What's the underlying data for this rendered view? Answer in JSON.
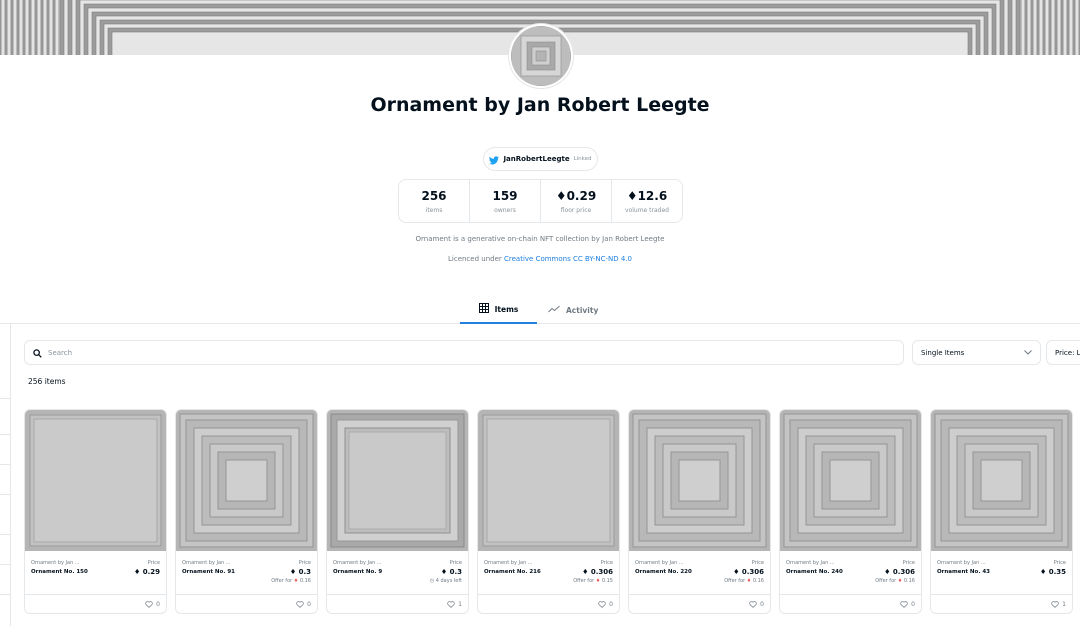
{
  "collection": {
    "title": "Ornament by Jan Robert Leegte",
    "twitter_handle": "JanRobertLeegte",
    "twitter_status": "Linked",
    "description": "Ornament is a generative on-chain NFT collection by Jan Robert Leegte",
    "licence_prefix": "Licenced under ",
    "licence_link": "Creative Commons CC BY-NC-ND 4.0"
  },
  "stats": [
    {
      "value": "256",
      "label": "items"
    },
    {
      "value": "159",
      "label": "owners"
    },
    {
      "value": "0.29",
      "label": "floor price",
      "eth": true
    },
    {
      "value": "12.6",
      "label": "volume traded",
      "eth": true
    }
  ],
  "tabs": {
    "items_label": "Items",
    "activity_label": "Activity"
  },
  "toolbar": {
    "search_placeholder": "Search",
    "item_type": "Single Items",
    "sort": "Price: Lo"
  },
  "item_count": "256 items",
  "cards": [
    {
      "collection": "Ornament by Jan ...",
      "name": "Ornament No. 150",
      "price_label": "Price",
      "price": "0.29",
      "extra": "",
      "offer": "",
      "likes": "0",
      "pattern": "plain"
    },
    {
      "collection": "Ornament by Jan ...",
      "name": "Ornament No. 91",
      "price_label": "Price",
      "price": "0.3",
      "extra": "Offer for ",
      "offer": "0.16",
      "likes": "0",
      "pattern": "nested"
    },
    {
      "collection": "Ornament by Jan ...",
      "name": "Ornament No. 9",
      "price_label": "Price",
      "price": "0.3",
      "extra": "4 days left",
      "offer": "",
      "likes": "1",
      "pattern": "bevel"
    },
    {
      "collection": "Ornament by Jan ...",
      "name": "Ornament No. 216",
      "price_label": "Price",
      "price": "0.306",
      "extra": "Offer for ",
      "offer": "0.15",
      "likes": "0",
      "pattern": "plain"
    },
    {
      "collection": "Ornament by Jan ...",
      "name": "Ornament No. 220",
      "price_label": "Price",
      "price": "0.306",
      "extra": "Offer for ",
      "offer": "0.16",
      "likes": "0",
      "pattern": "nested"
    },
    {
      "collection": "Ornament by Jan ...",
      "name": "Ornament No. 240",
      "price_label": "Price",
      "price": "0.306",
      "extra": "Offer for ",
      "offer": "0.16",
      "likes": "0",
      "pattern": "nested"
    },
    {
      "collection": "Ornament by Jan ...",
      "name": "Ornament No. 43",
      "price_label": "Price",
      "price": "0.35",
      "extra": "",
      "offer": "",
      "likes": "1",
      "pattern": "nested"
    }
  ],
  "colors": {
    "accent": "#2081e2",
    "text": "#04111d",
    "muted": "#707a83",
    "offer_eth": "#eb5757"
  },
  "icons": {
    "twitter": "twitter-bird-icon",
    "eth": "ethereum-icon",
    "grid": "grid-icon",
    "activity": "activity-chart-icon",
    "search": "search-icon",
    "chevron": "chevron-down-icon",
    "heart": "heart-icon",
    "clock": "clock-icon"
  }
}
